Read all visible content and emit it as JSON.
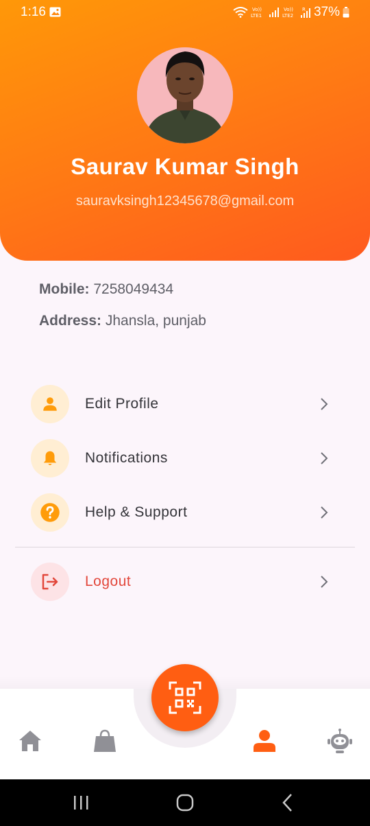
{
  "status_bar": {
    "time": "1:16",
    "battery": "37%",
    "icons": [
      "gallery-icon",
      "wifi-icon",
      "volte-lte1-icon",
      "signal-icon",
      "volte-lte2-icon",
      "signal-roaming-icon",
      "battery-icon"
    ]
  },
  "profile": {
    "name": "Saurav Kumar Singh",
    "email": "sauravksingh12345678@gmail.com",
    "avatar": "avatar-photo"
  },
  "info": {
    "mobile_label": "Mobile:",
    "mobile_value": "7258049434",
    "address_label": "Address:",
    "address_value": "Jhansla, punjab"
  },
  "menu": [
    {
      "label": "Edit Profile",
      "icon": "person-icon"
    },
    {
      "label": "Notifications",
      "icon": "bell-icon"
    },
    {
      "label": "Help & Support",
      "icon": "help-icon"
    }
  ],
  "logout": {
    "label": "Logout",
    "icon": "logout-icon"
  },
  "bottom_nav": {
    "items": [
      "home-icon",
      "shopping-bag-icon",
      "qr-code-icon",
      "profile-icon",
      "bot-icon"
    ],
    "active": "profile-icon"
  },
  "colors": {
    "accent": "#ff6a13",
    "gradient_start": "#ff9808",
    "gradient_end": "#ff5a1e",
    "logout": "#e2473b",
    "icon_bg": "#ffeed3"
  }
}
